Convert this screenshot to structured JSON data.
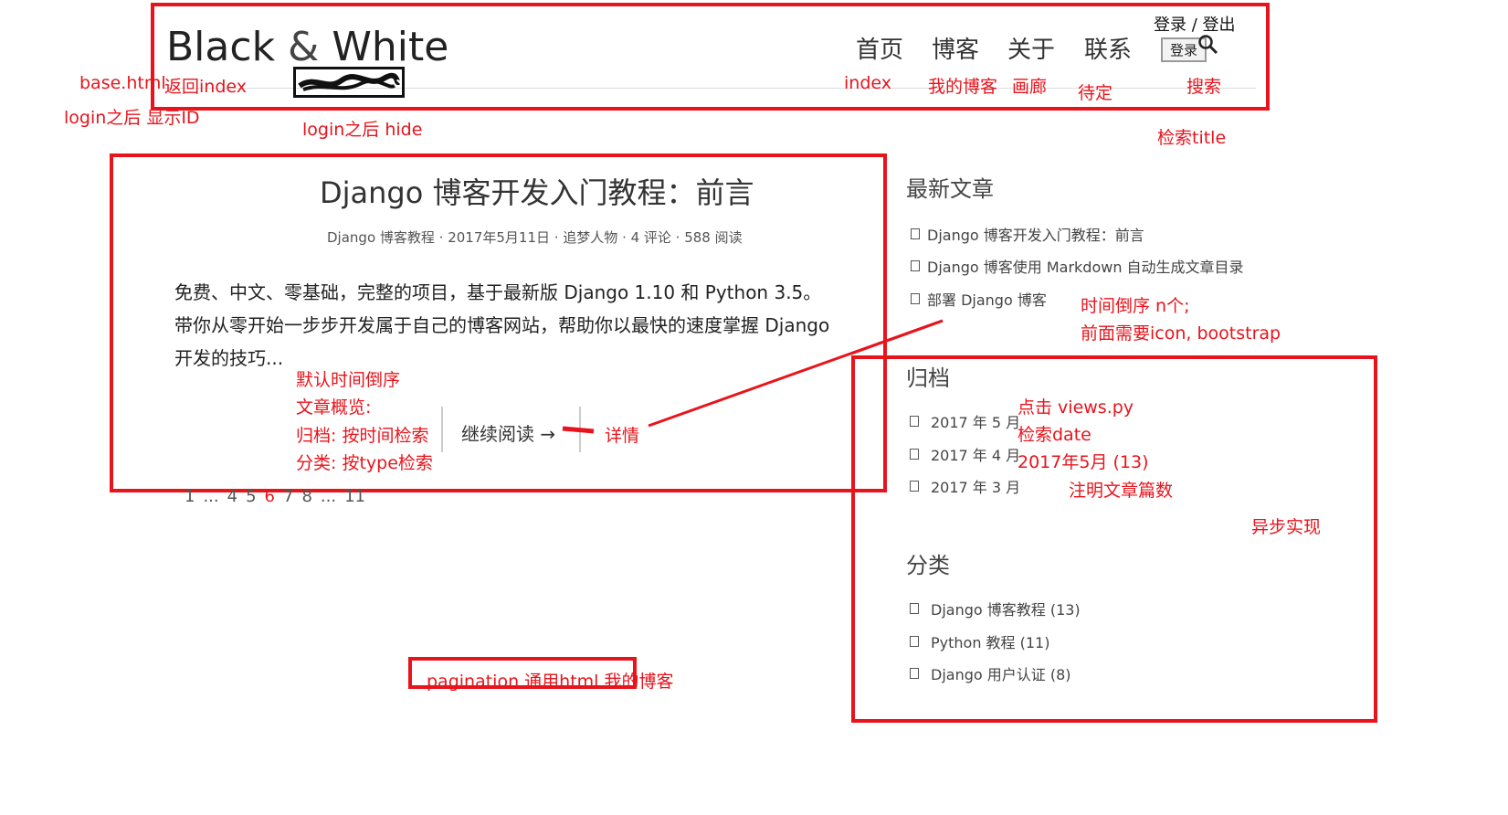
{
  "header": {
    "logo_black": "Black",
    "logo_amp": "&",
    "logo_white": "White",
    "nav": [
      "首页",
      "博客",
      "关于",
      "联系"
    ],
    "login_logout": "登录 / 登出",
    "login_button": "登录"
  },
  "annotations": {
    "base_html": "base.html",
    "back_index": "返回index",
    "login_show_id": "login之后 显示ID",
    "login_hide": "login之后 hide",
    "nav_notes": [
      "index",
      "我的博客",
      "画廊",
      "待定"
    ],
    "search": "搜索",
    "search_title": "检索title",
    "latest_note_1": "时间倒序 n个;",
    "latest_note_2": "前面需要icon, bootstrap",
    "post_notes": [
      "默认时间倒序",
      "文章概览:",
      "归档: 按时间检索",
      "分类: 按type检索"
    ],
    "detail": "详情",
    "archive_notes": [
      "点击 views.py",
      "检索date",
      "2017年5月 (13)",
      "注明文章篇数"
    ],
    "async": "异步实现",
    "pagination_note": "pagination 通用html 我的博客"
  },
  "post": {
    "title": "Django 博客开发入门教程：前言",
    "meta": "Django 博客教程 · 2017年5月11日 · 追梦人物 · 4 评论 · 588 阅读",
    "excerpt": "免费、中文、零基础，完整的项目，基于最新版 Django 1.10 和 Python 3.5。带你从零开始一步步开发属于自己的博客网站，帮助你以最快的速度掌握 Django 开发的技巧...",
    "read_more": "继续阅读 →"
  },
  "pagination": {
    "items": [
      "1",
      "...",
      "4",
      "5",
      "6",
      "7",
      "8",
      "...",
      "11"
    ],
    "current": "6"
  },
  "sidebar": {
    "latest_title": "最新文章",
    "latest": [
      "Django 博客开发入门教程：前言",
      "Django 博客使用 Markdown 自动生成文章目录",
      "部署 Django 博客"
    ],
    "archive_title": "归档",
    "archive": [
      "2017 年 5 月",
      "2017 年 4 月",
      "2017 年 3 月"
    ],
    "category_title": "分类",
    "categories": [
      "Django 博客教程 (13)",
      "Python 教程 (11)",
      "Django 用户认证 (8)"
    ]
  },
  "colors": {
    "annotation_red": "#e8141c"
  }
}
